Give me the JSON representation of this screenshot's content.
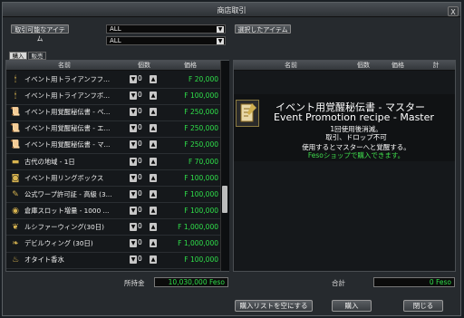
{
  "window": {
    "title": "商店取引",
    "close": "X"
  },
  "left": {
    "filter_label": "取引可能なアイテム",
    "select1": "ALL",
    "select2": "ALL",
    "tab_buy": "購入",
    "tab_sell": "販売",
    "col_name": "名前",
    "col_qty": "個数",
    "col_price": "価格",
    "items": [
      {
        "icon": "candle-icon",
        "glyph": "🕯",
        "name": "イベント用トライアンフフ...",
        "qty": "0",
        "price": "F 20,000"
      },
      {
        "icon": "candle-icon",
        "glyph": "🕯",
        "name": "イベント用トライアンフボ...",
        "qty": "0",
        "price": "F 100,000"
      },
      {
        "icon": "scroll-icon",
        "glyph": "📜",
        "name": "イベント用覚醒秘伝書 - ベ...",
        "qty": "0",
        "price": "F 250,000"
      },
      {
        "icon": "scroll-icon",
        "glyph": "📜",
        "name": "イベント用覚醒秘伝書 - エ...",
        "qty": "0",
        "price": "F 250,000"
      },
      {
        "icon": "scroll-icon",
        "glyph": "📜",
        "name": "イベント用覚醒秘伝書 - マ...",
        "qty": "0",
        "price": "F 250,000"
      },
      {
        "icon": "ticket-icon",
        "glyph": "▬",
        "name": "古代の地域 - 1日",
        "qty": "0",
        "price": "F 70,000"
      },
      {
        "icon": "ring-box-icon",
        "glyph": "◙",
        "name": "イベント用リングボックス",
        "qty": "0",
        "price": "F 100,000"
      },
      {
        "icon": "warp-permit-icon",
        "glyph": "✎",
        "name": "公式ワープ許可証 - 高級 (3...",
        "qty": "0",
        "price": "F 100,000"
      },
      {
        "icon": "medal-icon",
        "glyph": "◉",
        "name": "倉庫スロット増量 - 1000 ...",
        "qty": "0",
        "price": "F 100,000"
      },
      {
        "icon": "wing-icon",
        "glyph": "❦",
        "name": "ルシファーウィング(30日)",
        "qty": "0",
        "price": "F 1,000,000"
      },
      {
        "icon": "wing-icon",
        "glyph": "❧",
        "name": "デビルウィング (30日)",
        "qty": "0",
        "price": "F 1,000,000"
      },
      {
        "icon": "perfume-icon",
        "glyph": "♨",
        "name": "オタイト香水",
        "qty": "0",
        "price": "F 100,000"
      }
    ],
    "money_label": "所持金",
    "money_value": "10,030,000 Feso"
  },
  "right": {
    "selected_label": "選択したアイテム",
    "col_name": "名前",
    "col_qty": "個数",
    "col_price": "価格",
    "col_total": "計",
    "detail": {
      "name_jp": "イベント用覚醒秘伝書 - マスター",
      "name_en": "Event Promotion recipe - Master",
      "line1": "1回使用後消滅。",
      "line2": "取引、ドロップ不可",
      "line3": "使用するとマスターへと覚醒する。",
      "line4": "Fesoショップで購入できます。"
    },
    "total_label": "合計",
    "total_value": "0 Feso"
  },
  "buttons": {
    "clear": "購入リストを空にする",
    "buy": "購入",
    "close": "閉じる"
  }
}
